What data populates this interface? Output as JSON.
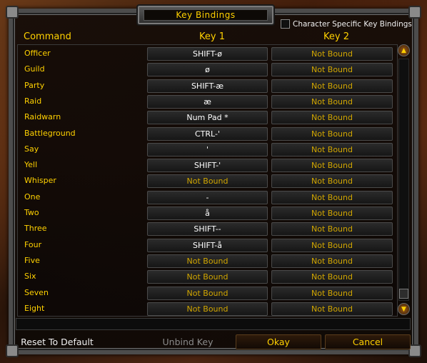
{
  "window": {
    "title": "Key Bindings"
  },
  "headers": {
    "command": "Command",
    "key1": "Key 1",
    "key2": "Key 2"
  },
  "character_specific": {
    "label": "Character Specific Key Bindings",
    "checked": false
  },
  "bindings": [
    {
      "command": "Officer",
      "key1": "SHIFT-ø",
      "key2": "Not Bound"
    },
    {
      "command": "Guild",
      "key1": "ø",
      "key2": "Not Bound"
    },
    {
      "command": "Party",
      "key1": "SHIFT-æ",
      "key2": "Not Bound"
    },
    {
      "command": "Raid",
      "key1": "æ",
      "key2": "Not Bound"
    },
    {
      "command": "Raidwarn",
      "key1": "Num Pad *",
      "key2": "Not Bound"
    },
    {
      "command": "Battleground",
      "key1": "CTRL-'",
      "key2": "Not Bound"
    },
    {
      "command": "Say",
      "key1": "'",
      "key2": "Not Bound"
    },
    {
      "command": "Yell",
      "key1": "SHIFT-'",
      "key2": "Not Bound"
    },
    {
      "command": "Whisper",
      "key1": "Not Bound",
      "key2": "Not Bound"
    },
    {
      "command": "One",
      "key1": "-",
      "key2": "Not Bound"
    },
    {
      "command": "Two",
      "key1": "å",
      "key2": "Not Bound"
    },
    {
      "command": "Three",
      "key1": "SHIFT--",
      "key2": "Not Bound"
    },
    {
      "command": "Four",
      "key1": "SHIFT-å",
      "key2": "Not Bound"
    },
    {
      "command": "Five",
      "key1": "Not Bound",
      "key2": "Not Bound"
    },
    {
      "command": "Six",
      "key1": "Not Bound",
      "key2": "Not Bound"
    },
    {
      "command": "Seven",
      "key1": "Not Bound",
      "key2": "Not Bound"
    },
    {
      "command": "Eight",
      "key1": "Not Bound",
      "key2": "Not Bound"
    }
  ],
  "unbound_text": "Not Bound",
  "scrollbar": {
    "up_icon": "arrow-up-icon",
    "down_icon": "arrow-down-icon"
  },
  "buttons": {
    "reset": "Reset To Default",
    "unbind": "Unbind Key",
    "okay": "Okay",
    "cancel": "Cancel"
  },
  "colors": {
    "gold": "#ffd100",
    "white": "#ffffff",
    "disabled": "#8a8a8a"
  }
}
